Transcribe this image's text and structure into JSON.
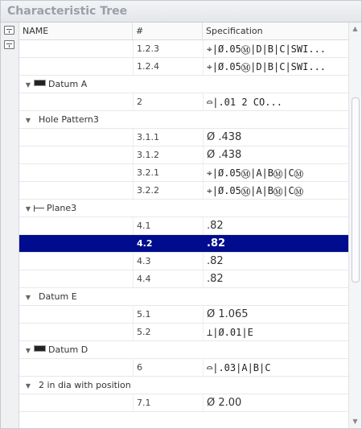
{
  "panel": {
    "title": "Characteristic Tree"
  },
  "columns": {
    "name": "NAME",
    "num": "#",
    "spec": "Specification"
  },
  "rows": [
    {
      "type": "item",
      "num": "1.2.3",
      "spec": "⌖|Ø.05Ⓜ|D|B|C|SWI..."
    },
    {
      "type": "item",
      "num": "1.2.4",
      "spec": "⌖|Ø.05Ⓜ|D|B|C|SWI..."
    },
    {
      "type": "group",
      "label": "Datum A",
      "icon": "datum-icon"
    },
    {
      "type": "item",
      "num": "2",
      "spec": "⌓|.01    2 CO..."
    },
    {
      "type": "group",
      "label": "Hole Pattern3",
      "icon": ""
    },
    {
      "type": "item",
      "num": "3.1.1",
      "spec": "Ø .438"
    },
    {
      "type": "item",
      "num": "3.1.2",
      "spec": "Ø .438"
    },
    {
      "type": "item",
      "num": "3.2.1",
      "spec": "⌖|Ø.05Ⓜ|A|BⓂ|CⓂ"
    },
    {
      "type": "item",
      "num": "3.2.2",
      "spec": "⌖|Ø.05Ⓜ|A|BⓂ|CⓂ"
    },
    {
      "type": "group",
      "label": "Plane3",
      "icon": "plane-icon"
    },
    {
      "type": "item",
      "num": "4.1",
      "spec": ".82"
    },
    {
      "type": "item",
      "num": "4.2",
      "spec": ".82",
      "selected": true
    },
    {
      "type": "item",
      "num": "4.3",
      "spec": ".82"
    },
    {
      "type": "item",
      "num": "4.4",
      "spec": ".82"
    },
    {
      "type": "group",
      "label": "Datum E",
      "icon": ""
    },
    {
      "type": "item",
      "num": "5.1",
      "spec": "Ø 1.065"
    },
    {
      "type": "item",
      "num": "5.2",
      "spec": "⊥|Ø.01|E"
    },
    {
      "type": "group",
      "label": "Datum D",
      "icon": "datum-icon"
    },
    {
      "type": "item",
      "num": "6",
      "spec": "⌓|.03|A|B|C"
    },
    {
      "type": "group",
      "label": "2 in dia with position",
      "icon": ""
    },
    {
      "type": "item",
      "num": "7.1",
      "spec": "Ø 2.00"
    }
  ],
  "colors": {
    "selected": "#000c8e",
    "title": "#9aa0a8"
  }
}
